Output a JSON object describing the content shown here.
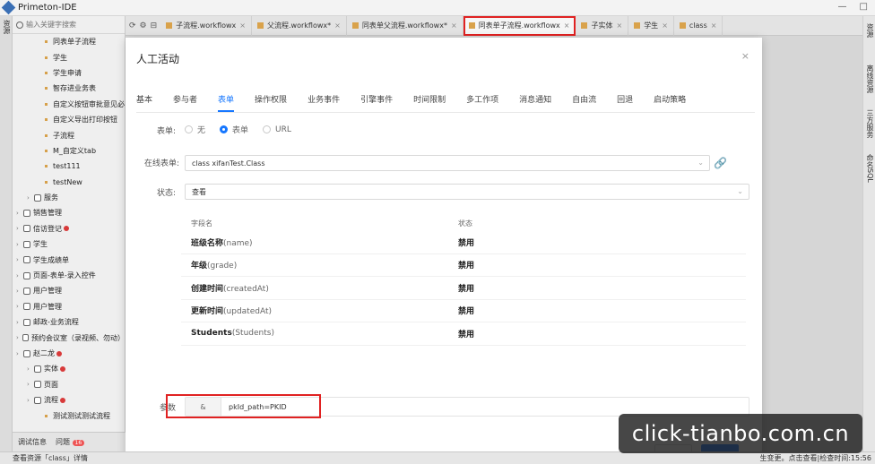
{
  "app": {
    "title": "Primeton-IDE",
    "window_controls": [
      "—",
      "□"
    ]
  },
  "left_strip": {
    "label": "资源"
  },
  "right_strip": {
    "labels": [
      "资源",
      "离线资源",
      "三方服务",
      "命名SQL"
    ]
  },
  "sidebar": {
    "search_placeholder": "输入关键字搜索",
    "items": [
      {
        "label": "同表单子流程",
        "kind": "leaf"
      },
      {
        "label": "学生",
        "kind": "leaf"
      },
      {
        "label": "学生申请",
        "kind": "leaf"
      },
      {
        "label": "智存进业务表",
        "kind": "leaf"
      },
      {
        "label": "自定义按钮审批意见必",
        "kind": "leaf"
      },
      {
        "label": "自定义导出打印按钮",
        "kind": "leaf"
      },
      {
        "label": "子流程",
        "kind": "leaf"
      },
      {
        "label": "M_自定义tab",
        "kind": "leaf"
      },
      {
        "label": "test111",
        "kind": "leaf"
      },
      {
        "label": "testNew",
        "kind": "leaf"
      },
      {
        "label": "服务",
        "kind": "node-l2"
      },
      {
        "label": "销售管理",
        "kind": "node",
        "badge": false
      },
      {
        "label": "信访登记",
        "kind": "node",
        "badge": true
      },
      {
        "label": "学生",
        "kind": "node",
        "badge": false
      },
      {
        "label": "学生成绩单",
        "kind": "node",
        "badge": false
      },
      {
        "label": "页面-表单-录入控件",
        "kind": "node",
        "badge": false
      },
      {
        "label": "用户管理",
        "kind": "node",
        "badge": false
      },
      {
        "label": "用户管理",
        "kind": "node",
        "badge": false
      },
      {
        "label": "邮政-业务流程",
        "kind": "node",
        "badge": false
      },
      {
        "label": "预约会议室（录视频、勿动）",
        "kind": "node",
        "badge": false
      },
      {
        "label": "赵二龙",
        "kind": "node",
        "badge": true
      },
      {
        "label": "实体",
        "kind": "node-l2",
        "badge": true
      },
      {
        "label": "页面",
        "kind": "node-l2",
        "badge": false
      },
      {
        "label": "流程",
        "kind": "node-l2",
        "badge": true
      },
      {
        "label": "测试测试测试流程",
        "kind": "leaf",
        "badge": false
      }
    ],
    "bottom_tabs": [
      {
        "label": "调试信息"
      },
      {
        "label": "问题",
        "count": "16"
      }
    ]
  },
  "tabbar": {
    "tool_icons": [
      "refresh-icon",
      "settings-icon",
      "collapse-icon"
    ],
    "tabs": [
      {
        "label": "子流程.workflowx",
        "active": false
      },
      {
        "label": "父流程.workflowx*",
        "active": false
      },
      {
        "label": "同表单父流程.workflowx*",
        "active": false
      },
      {
        "label": "同表单子流程.workflowx",
        "active": true
      },
      {
        "label": "子实体",
        "active": false
      },
      {
        "label": "学生",
        "active": false
      },
      {
        "label": "class",
        "active": false
      }
    ]
  },
  "statusbar": {
    "left": "查看资源「class」详情",
    "right": "生变更。点击查看|检查时间:15:56"
  },
  "modal": {
    "title": "人工活动",
    "close": "×",
    "tabs": [
      "基本",
      "参与者",
      "表单",
      "操作权限",
      "业务事件",
      "引擎事件",
      "时间限制",
      "多工作项",
      "消息通知",
      "自由流",
      "回退",
      "启动策略"
    ],
    "active_tab": "表单",
    "form_type": {
      "label": "表单:",
      "options": [
        {
          "label": "无",
          "checked": false
        },
        {
          "label": "表单",
          "checked": true
        },
        {
          "label": "URL",
          "checked": false
        }
      ]
    },
    "online_form": {
      "label": "在线表单:",
      "value": "class xifanTest.Class"
    },
    "status": {
      "label": "状态:",
      "value": "查看"
    },
    "field_table": {
      "headers": [
        "字段名",
        "状态"
      ],
      "rows": [
        {
          "name": "班级名称",
          "code": "(name)",
          "state": "禁用"
        },
        {
          "name": "年级",
          "code": "(grade)",
          "state": "禁用"
        },
        {
          "name": "创建时间",
          "code": "(createdAt)",
          "state": "禁用"
        },
        {
          "name": "更新时间",
          "code": "(updatedAt)",
          "state": "禁用"
        },
        {
          "name": "Students",
          "code": "(Students)",
          "state": "禁用"
        }
      ]
    },
    "params": {
      "label": "参数",
      "prefix": "&",
      "value": "pkId_path=PKID"
    }
  },
  "watermark": {
    "text": "click-tianbo.com.cn"
  }
}
